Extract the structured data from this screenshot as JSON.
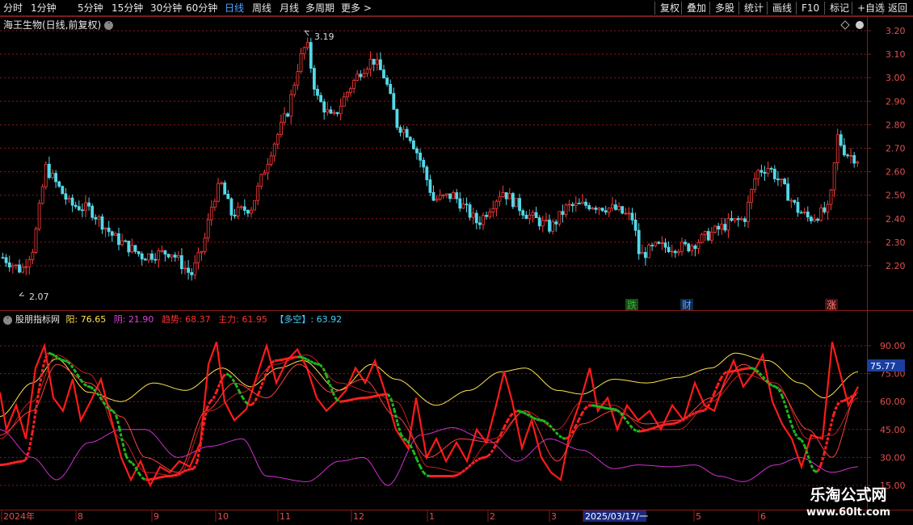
{
  "toolbar": {
    "periods": [
      "分时",
      "1分钟",
      "5分钟",
      "15分钟",
      "30分钟",
      "60分钟",
      "日线",
      "周线",
      "月线",
      "多周期",
      "更多 >"
    ],
    "active_period": "日线",
    "right_buttons": [
      "复权",
      "叠加",
      "多股",
      "统计",
      "画线",
      "F10",
      "标记",
      "+自选",
      "返回"
    ]
  },
  "main_chart": {
    "title": "海王生物(日线,前复权)",
    "price_axis": [
      "3.20",
      "3.10",
      "3.00",
      "2.90",
      "2.80",
      "2.70",
      "2.60",
      "2.50",
      "2.40",
      "2.30",
      "2.20"
    ],
    "high_label": "3.19",
    "low_label": "2.07",
    "markers": [
      {
        "text": "跌",
        "color": "#2db82d"
      },
      {
        "text": "财",
        "color": "#5aa0ff"
      },
      {
        "text": "涨",
        "color": "#c0392b"
      }
    ],
    "colors": {
      "up": "#ff3b3b",
      "down": "#54d8e8",
      "grid": "#8b1a1a"
    }
  },
  "indicator": {
    "name": "股朋指标网",
    "values": [
      {
        "label": "阳:",
        "value": "76.65",
        "color": "#ffe34d"
      },
      {
        "label": "阴:",
        "value": "21.90",
        "color": "#e040e0"
      },
      {
        "label": "趋势:",
        "value": "68.37",
        "color": "#ff3030"
      },
      {
        "label": "主力:",
        "value": "61.95",
        "color": "#ff3030"
      },
      {
        "label": "【多空】:",
        "value": "63.92",
        "color": "#40d0ff"
      }
    ],
    "axis": [
      "90.00",
      "75.00",
      "60.00",
      "45.00",
      "30.00",
      "15.00"
    ],
    "current_value": "75.77"
  },
  "time_axis": {
    "labels": [
      "2024年",
      "8",
      "9",
      "10",
      "11",
      "12",
      "1",
      "2",
      "3",
      "2025/03/17/一",
      "5",
      "6"
    ]
  },
  "watermark": {
    "line1": "乐淘公式网",
    "line2": "www.60lt.com"
  }
}
